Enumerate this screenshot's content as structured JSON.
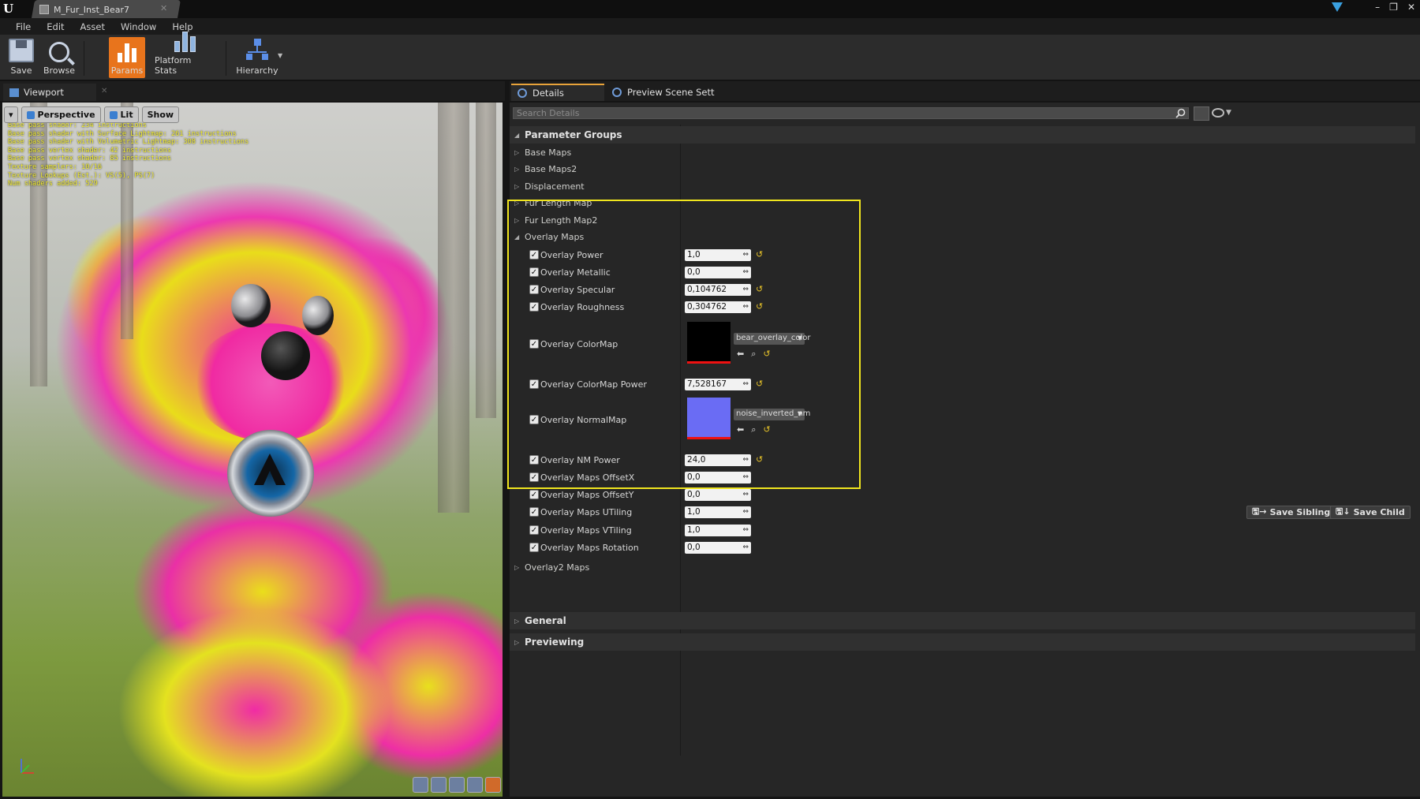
{
  "window": {
    "tab_title": "M_Fur_Inst_Bear7",
    "controls": [
      "–",
      "❐",
      "✕"
    ]
  },
  "menu": [
    "File",
    "Edit",
    "Asset",
    "Window",
    "Help"
  ],
  "toolbar": {
    "save": "Save",
    "browse": "Browse",
    "params": "Params",
    "platform_stats": "Platform Stats",
    "hierarchy": "Hierarchy",
    "active_color": "#e8741c"
  },
  "viewport": {
    "tab": "Viewport",
    "buttons": {
      "perspective": "Perspective",
      "lit": "Lit",
      "show": "Show"
    },
    "stats": [
      "Base pass shader: 234 instructions",
      "Base pass shader with Surface Lightmap: 261 instructions",
      "Base pass shader with Volumetric Lightmap: 308 instructions",
      "Base pass vertex shader: 42 instructions",
      "Base pass vertex shader: 85 instructions",
      "Texture samplers: 10/16",
      "Texture Lookups (Est.): VS(5), PS(7)",
      "Num shaders added: 529"
    ],
    "stats_color": "#f4ee30"
  },
  "details": {
    "tabs": [
      "Details",
      "Preview Scene Sett"
    ],
    "search_placeholder": "Search Details",
    "category": "Parameter Groups",
    "groups_before": [
      "Base Maps",
      "Base Maps2",
      "Displacement",
      "Fur Length Map",
      "Fur Length Map2"
    ],
    "overlay_group": "Overlay Maps",
    "params": [
      {
        "label": "Overlay Power",
        "value": "1,0",
        "reset": true
      },
      {
        "label": "Overlay Metallic",
        "value": "0,0",
        "reset": false
      },
      {
        "label": "Overlay Specular",
        "value": "0,104762",
        "reset": true
      },
      {
        "label": "Overlay Roughness",
        "value": "0,304762",
        "reset": true
      }
    ],
    "colormap": {
      "label": "Overlay ColorMap",
      "asset": "bear_overlay_color"
    },
    "colormap_power": {
      "label": "Overlay ColorMap Power",
      "value": "7,528167"
    },
    "normalmap": {
      "label": "Overlay NormalMap",
      "asset": "noise_inverted_nm",
      "swatch": "#6a6cf4"
    },
    "params2": [
      {
        "label": "Overlay NM Power",
        "value": "24,0",
        "reset": true
      },
      {
        "label": "Overlay Maps OffsetX",
        "value": "0,0",
        "reset": false
      },
      {
        "label": "Overlay Maps OffsetY",
        "value": "0,0",
        "reset": false
      },
      {
        "label": "Overlay Maps UTiling",
        "value": "1,0",
        "reset": false
      },
      {
        "label": "Overlay Maps VTiling",
        "value": "1,0",
        "reset": false
      },
      {
        "label": "Overlay Maps Rotation",
        "value": "0,0",
        "reset": false
      }
    ],
    "groups_after": [
      "Overlay2 Maps"
    ],
    "save_sibling": "Save Sibling",
    "save_child": "Save Child",
    "categories_after": [
      "General",
      "Previewing"
    ],
    "highlight_color": "#f0e51e"
  }
}
